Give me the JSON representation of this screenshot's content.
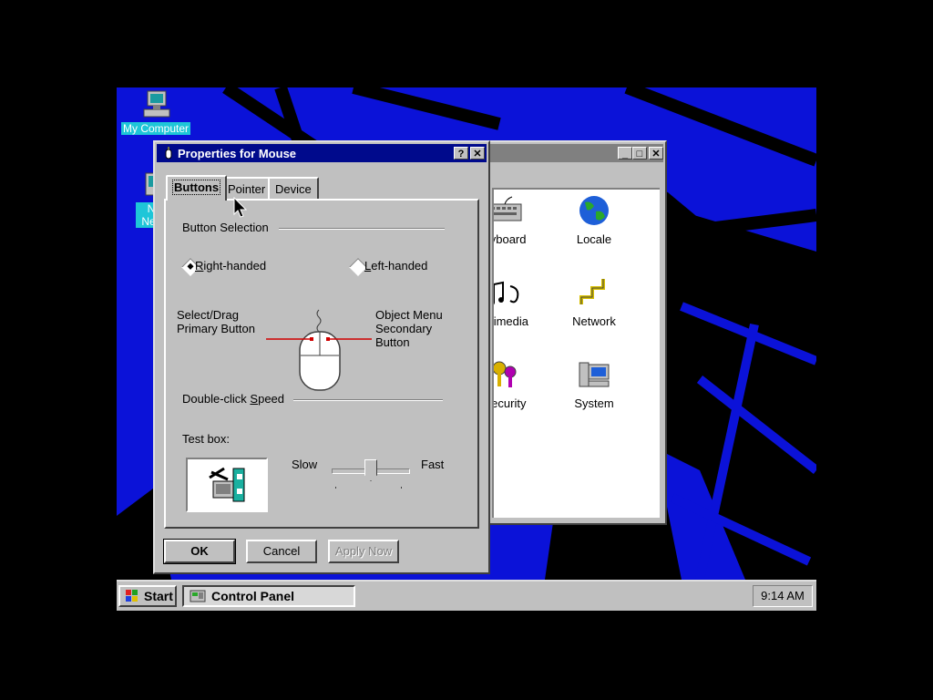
{
  "desktop": {
    "icons": [
      {
        "label": "My Computer",
        "icon": "my-computer-icon"
      },
      {
        "label": "Net Neigh",
        "icon": "network-neighborhood-icon"
      }
    ]
  },
  "control_panel": {
    "items": [
      {
        "label": "eyboard",
        "icon": "keyboard-icon"
      },
      {
        "label": "Locale",
        "icon": "globe-icon"
      },
      {
        "label": "ultimedia",
        "icon": "multimedia-icon"
      },
      {
        "label": "Network",
        "icon": "network-icon"
      },
      {
        "label": "Security",
        "icon": "security-keys-icon"
      },
      {
        "label": "System",
        "icon": "system-computer-icon"
      }
    ]
  },
  "mouse_dialog": {
    "title": "Properties for Mouse",
    "help_button": "?",
    "close_button": "✕",
    "tabs": [
      {
        "label": "Buttons",
        "active": true
      },
      {
        "label": "Pointer",
        "active": false
      },
      {
        "label": "Device",
        "active": false
      }
    ],
    "button_selection": {
      "heading": "Button Selection",
      "right_handed": {
        "prefix": "R",
        "rest": "ight-handed",
        "selected": true
      },
      "left_handed": {
        "prefix": "L",
        "rest": "eft-handed",
        "selected": false
      }
    },
    "left_label": [
      "Select/Drag",
      "Primary Button"
    ],
    "right_label": [
      "Object Menu",
      "Secondary",
      "Button"
    ],
    "double_click": {
      "heading_pre": "Double-click ",
      "heading_u": "S",
      "heading_post": "peed",
      "test_box_label": "Test box:",
      "slow": "Slow",
      "fast": "Fast",
      "speed": 0.5
    },
    "buttons": {
      "ok": "OK",
      "cancel": "Cancel",
      "apply": "Apply Now"
    }
  },
  "taskbar": {
    "start": "Start",
    "task": "Control Panel",
    "clock": "9:14 AM"
  },
  "colors": {
    "desktop": "#0b12d8",
    "titlebar_active": "#000a8c",
    "face": "#c0c0c0"
  }
}
